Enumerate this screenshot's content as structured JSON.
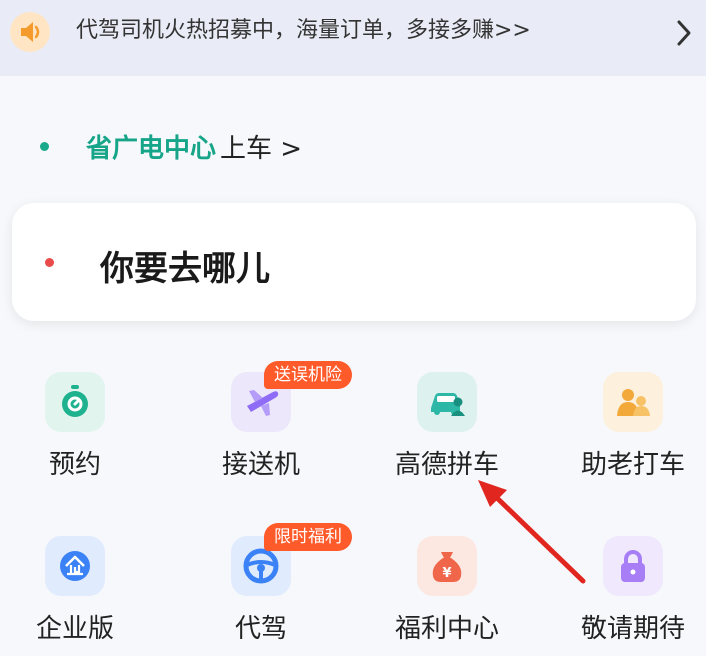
{
  "banner": {
    "text": "代驾司机火热招募中，海量订单，多接多赚>>",
    "icon": "speaker-icon"
  },
  "pickup": {
    "place": "省广电中心",
    "suffix": "上车 >"
  },
  "destination": {
    "prompt": "你要去哪儿"
  },
  "services": [
    {
      "label": "预约",
      "icon": "clock-icon",
      "color": "#1fb28f"
    },
    {
      "label": "接送机",
      "icon": "plane-icon",
      "color": "#8f6cf6",
      "badge": "送误机险"
    },
    {
      "label": "高德拼车",
      "icon": "carpool-icon",
      "color": "#2cb7a6"
    },
    {
      "label": "助老打车",
      "icon": "elderly-icon",
      "color": "#f3a83a"
    },
    {
      "label": "企业版",
      "icon": "enterprise-icon",
      "color": "#3b82f6"
    },
    {
      "label": "代驾",
      "icon": "steering-wheel-icon",
      "color": "#3b82f6",
      "badge": "限时福利"
    },
    {
      "label": "福利中心",
      "icon": "money-bag-icon",
      "color": "#f0664a"
    },
    {
      "label": "敬请期待",
      "icon": "lock-icon",
      "color": "#a77ef6"
    }
  ],
  "colors": {
    "accent": "#17a589",
    "badge": "#ff5a2a",
    "annotation_arrow": "#e0261f"
  }
}
